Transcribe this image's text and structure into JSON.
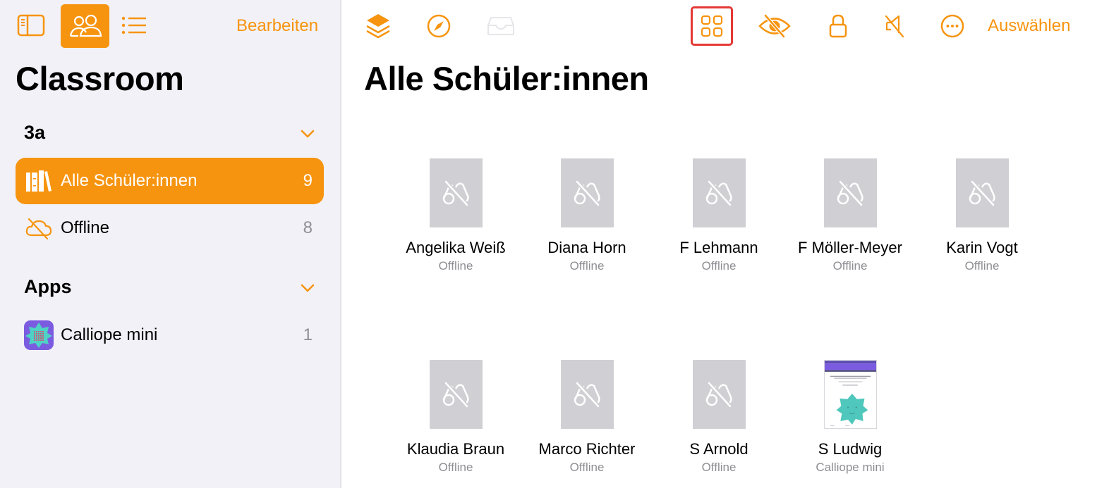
{
  "colors": {
    "accent": "#f7940f",
    "sidebar_bg": "#f2f1f7",
    "highlight_border": "#e53935",
    "thumb_placeholder": "#cfcfd4"
  },
  "sidebar": {
    "toolbar": {
      "icons": [
        "sidebar-toggle-icon",
        "people-icon",
        "list-icon"
      ],
      "edit_label": "Bearbeiten"
    },
    "title": "Classroom",
    "sections": [
      {
        "title": "3a",
        "items": [
          {
            "icon": "books-icon",
            "label": "Alle Schüler:innen",
            "count": "9",
            "selected": true
          },
          {
            "icon": "cloud-offline-icon",
            "label": "Offline",
            "count": "8",
            "selected": false
          }
        ]
      },
      {
        "title": "Apps",
        "items": [
          {
            "icon": "calliope-app-icon",
            "label": "Calliope mini",
            "count": "1",
            "selected": false
          }
        ]
      }
    ]
  },
  "main": {
    "toolbar": {
      "left_icons": [
        "layers-icon",
        "compass-icon",
        "tray-icon"
      ],
      "right_icons": [
        "grid-icon",
        "eye-slash-icon",
        "lock-icon",
        "speaker-mute-icon",
        "more-icon"
      ],
      "select_label": "Auswählen"
    },
    "title": "Alle Schüler:innen",
    "students": [
      {
        "name": "Angelika Weiß",
        "status": "Offline"
      },
      {
        "name": "Diana Horn",
        "status": "Offline"
      },
      {
        "name": "F Lehmann",
        "status": "Offline"
      },
      {
        "name": "F Möller-Meyer",
        "status": "Offline"
      },
      {
        "name": "Karin Vogt",
        "status": "Offline"
      },
      {
        "name": "Klaudia Braun",
        "status": "Offline"
      },
      {
        "name": "Marco Richter",
        "status": "Offline"
      },
      {
        "name": "S Arnold",
        "status": "Offline"
      },
      {
        "name": "S Ludwig",
        "status": "Calliope mini"
      }
    ]
  }
}
